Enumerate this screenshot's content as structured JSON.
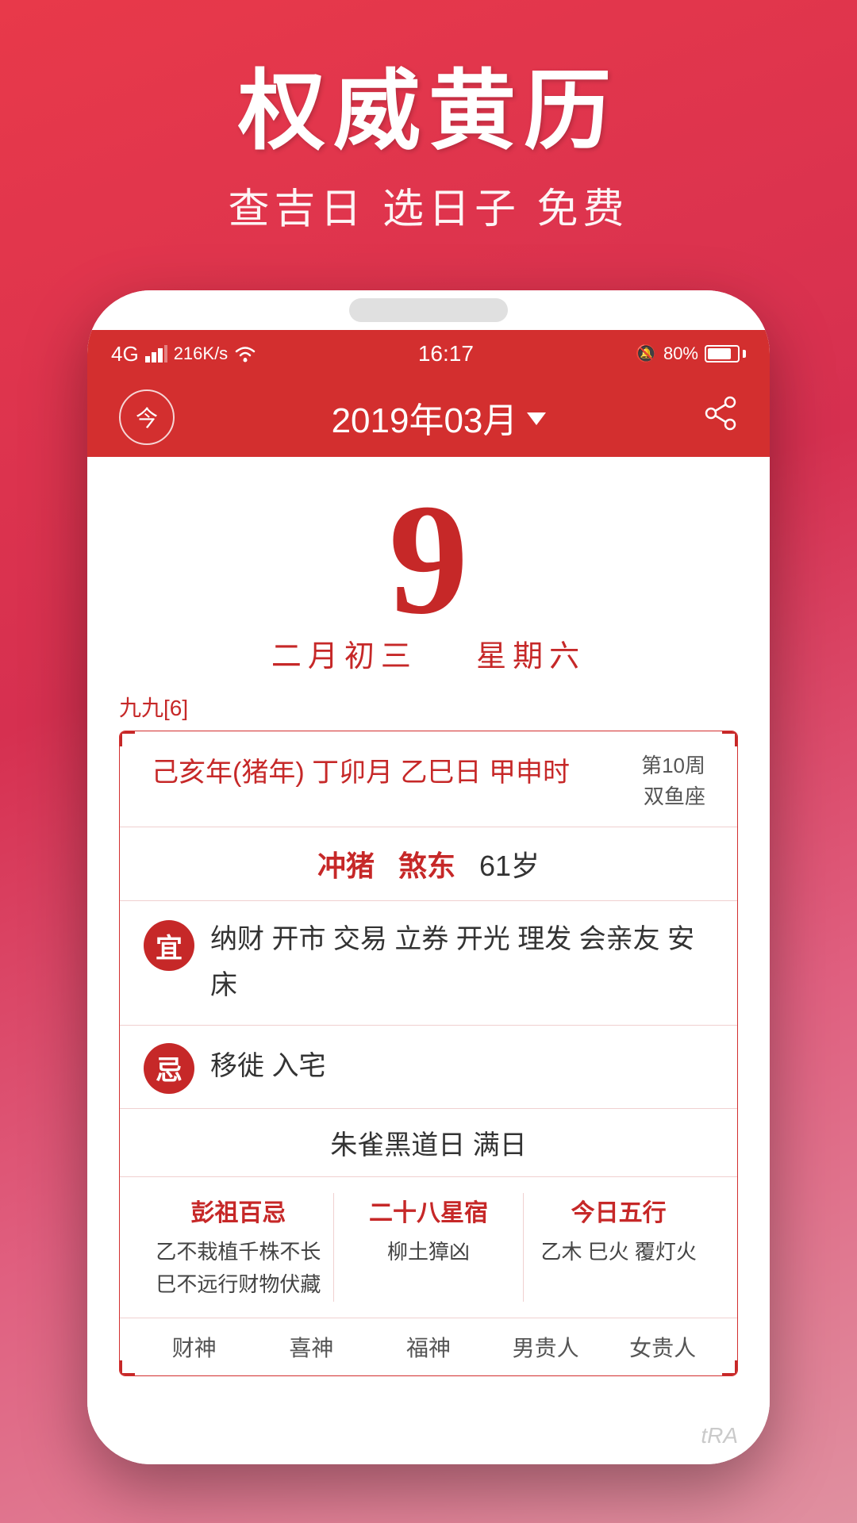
{
  "background": {
    "gradient_start": "#e8394a",
    "gradient_end": "#e090a0"
  },
  "top_promo": {
    "main_title": "权威黄历",
    "sub_title": "查吉日 选日子 免费"
  },
  "phone": {
    "status_bar": {
      "signal": "4G",
      "speed": "216K/s",
      "wifi": "wifi",
      "time": "16:17",
      "alert": "🔔",
      "battery_pct": "80%"
    },
    "app_header": {
      "today_label": "今",
      "month_display": "2019年03月",
      "dropdown_label": "▼"
    },
    "date_section": {
      "day_number": "9",
      "lunar_day": "二月初三",
      "weekday": "星期六"
    },
    "jiujiu": "九九[6]",
    "info_card": {
      "ganzhi": "己亥年(猪年) 丁卯月 乙巳日 甲申时",
      "week_info_line1": "第10周",
      "week_info_line2": "双鱼座",
      "chong": "冲猪",
      "sha": "煞东",
      "age": "61岁",
      "yi_label": "宜",
      "yi_items": "纳财 开市 交易 立券 开光 理发 会亲友 安床",
      "ji_label": "忌",
      "ji_items": "移徙 入宅",
      "zhuri": "朱雀黑道日   满日",
      "peng_zu_title": "彭祖百忌",
      "peng_za_content_1": "乙不栽植千株不长",
      "peng_za_content_2": "巳不远行财物伏藏",
      "xiu_title": "二十八星宿",
      "xiu_content": "柳土獐凶",
      "wuxing_title": "今日五行",
      "wuxing_content": "乙木 巳火 覆灯火",
      "gods": [
        "财神",
        "喜神",
        "福神",
        "男贵人",
        "女贵人"
      ]
    }
  },
  "watermark": "tRA"
}
